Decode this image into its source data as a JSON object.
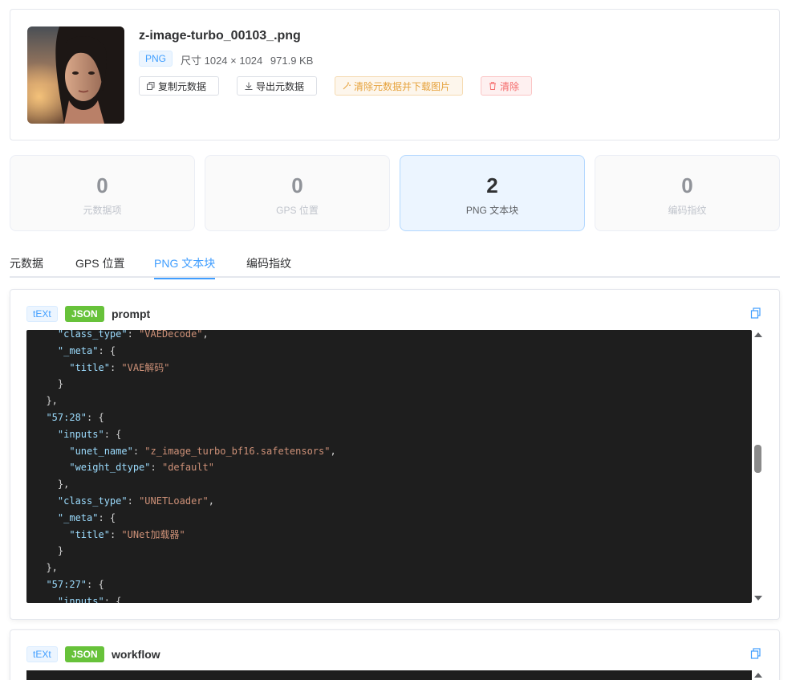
{
  "file": {
    "name": "z-image-turbo_00103_.png",
    "format": "PNG",
    "dimensions": "尺寸 1024 × 1024",
    "filesize": "971.9 KB"
  },
  "actions": {
    "copy": "复制元数据",
    "export": "导出元数据",
    "clean_download": "清除元数据并下载图片",
    "clear": "清除"
  },
  "stats": [
    {
      "count": "0",
      "label": "元数据项"
    },
    {
      "count": "0",
      "label": "GPS 位置"
    },
    {
      "count": "2",
      "label": "PNG 文本块"
    },
    {
      "count": "0",
      "label": "编码指纹"
    }
  ],
  "tabs": [
    "元数据",
    "GPS 位置",
    "PNG 文本块",
    "编码指纹"
  ],
  "active_tab": "PNG 文本块",
  "blocks": [
    {
      "chunk": "tEXt",
      "format": "JSON",
      "key": "prompt"
    },
    {
      "chunk": "tEXt",
      "format": "JSON",
      "key": "workflow"
    }
  ],
  "code_lines": [
    {
      "indent": 2,
      "parts": [
        [
          "k",
          "\"class_type\""
        ],
        [
          "p",
          ": "
        ],
        [
          "s",
          "\"VAEDecode\""
        ],
        [
          "p",
          ","
        ]
      ]
    },
    {
      "indent": 2,
      "parts": [
        [
          "k",
          "\"_meta\""
        ],
        [
          "p",
          ": {"
        ]
      ]
    },
    {
      "indent": 3,
      "parts": [
        [
          "k",
          "\"title\""
        ],
        [
          "p",
          ": "
        ],
        [
          "s",
          "\"VAE解码\""
        ]
      ]
    },
    {
      "indent": 2,
      "parts": [
        [
          "p",
          "}"
        ]
      ]
    },
    {
      "indent": 1,
      "parts": [
        [
          "p",
          "},"
        ]
      ]
    },
    {
      "indent": 1,
      "parts": [
        [
          "k",
          "\"57:28\""
        ],
        [
          "p",
          ": {"
        ]
      ]
    },
    {
      "indent": 2,
      "parts": [
        [
          "k",
          "\"inputs\""
        ],
        [
          "p",
          ": {"
        ]
      ]
    },
    {
      "indent": 3,
      "parts": [
        [
          "k",
          "\"unet_name\""
        ],
        [
          "p",
          ": "
        ],
        [
          "s",
          "\"z_image_turbo_bf16.safetensors\""
        ],
        [
          "p",
          ","
        ]
      ]
    },
    {
      "indent": 3,
      "parts": [
        [
          "k",
          "\"weight_dtype\""
        ],
        [
          "p",
          ": "
        ],
        [
          "s",
          "\"default\""
        ]
      ]
    },
    {
      "indent": 2,
      "parts": [
        [
          "p",
          "},"
        ]
      ]
    },
    {
      "indent": 2,
      "parts": [
        [
          "k",
          "\"class_type\""
        ],
        [
          "p",
          ": "
        ],
        [
          "s",
          "\"UNETLoader\""
        ],
        [
          "p",
          ","
        ]
      ]
    },
    {
      "indent": 2,
      "parts": [
        [
          "k",
          "\"_meta\""
        ],
        [
          "p",
          ": {"
        ]
      ]
    },
    {
      "indent": 3,
      "parts": [
        [
          "k",
          "\"title\""
        ],
        [
          "p",
          ": "
        ],
        [
          "s",
          "\"UNet加载器\""
        ]
      ]
    },
    {
      "indent": 2,
      "parts": [
        [
          "p",
          "}"
        ]
      ]
    },
    {
      "indent": 1,
      "parts": [
        [
          "p",
          "},"
        ]
      ]
    },
    {
      "indent": 1,
      "parts": [
        [
          "k",
          "\"57:27\""
        ],
        [
          "p",
          ": {"
        ]
      ]
    },
    {
      "indent": 2,
      "parts": [
        [
          "k",
          "\"inputs\""
        ],
        [
          "p",
          ": {"
        ]
      ]
    }
  ],
  "colors": {
    "accent": "#409eff",
    "success": "#67c23a",
    "warning": "#e6a23c",
    "danger": "#f56c6c",
    "code_bg": "#1e1e1e",
    "code_key": "#9cdcfe",
    "code_string": "#ce9178"
  },
  "icons": {
    "copy": "copy-icon",
    "export": "download-icon",
    "clean": "magic-wand-icon",
    "clear": "trash-icon"
  }
}
